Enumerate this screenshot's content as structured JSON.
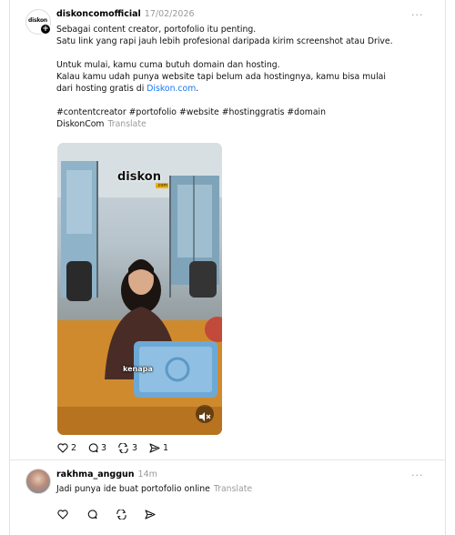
{
  "post": {
    "username": "diskoncomofficial",
    "date": "17/02/2026",
    "avatar_text": "diskon",
    "body_lines": [
      "Sebagai content creator, portofolio itu penting.",
      "Satu link yang rapi jauh lebih profesional daripada kirim screenshot atau Drive.",
      "Untuk mulai, kamu cuma butuh domain dan hosting.",
      "Kalau kamu udah punya website tapi belum ada hostingnya, kamu bisa mulai",
      "dari hosting gratis di "
    ],
    "link_text": "Diskon.com",
    "link_suffix": ".",
    "hashtags": "#contentcreator #portofolio #website #hostinggratis #domain",
    "signature": "DiskonCom",
    "translate_label": "Translate",
    "media": {
      "watermark": "diskon",
      "watermark_sub": ".com",
      "caption": "kenapa",
      "mute_icon": "speaker-muted-icon"
    },
    "actions": {
      "likes": "2",
      "comments": "3",
      "reposts": "3",
      "shares": "1"
    }
  },
  "reply": {
    "username": "rakhma_anggun",
    "time": "14m",
    "text": "Jadi punya ide buat portofolio online",
    "translate_label": "Translate"
  },
  "more_label": "...",
  "colors": {
    "link": "#1877f2",
    "muted": "#9a9a9a",
    "logo_accent": "#f2b400"
  }
}
